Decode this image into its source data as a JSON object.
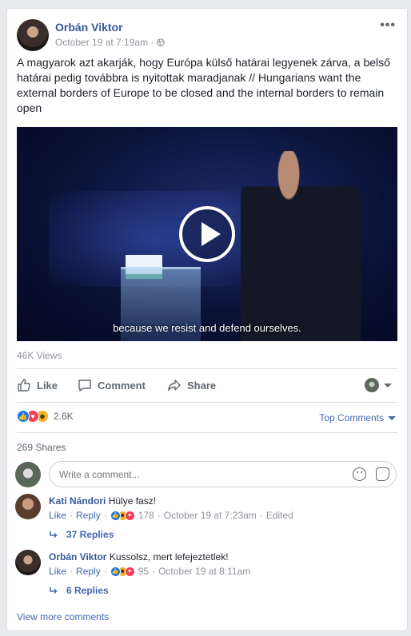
{
  "post": {
    "author": "Orbán Viktor",
    "timestamp": "October 19 at 7:19am",
    "privacy_icon": "globe-icon",
    "more_label": "•••",
    "text": "A magyarok azt akarják, hogy Európa külső határai legyenek zárva, a belső határai pedig továbbra is nyitottak maradjanak // Hungarians want the external borders of Europe to be closed and the internal borders to remain open",
    "video_subtitle": "because we resist and defend ourselves.",
    "views": "46K Views"
  },
  "actions": {
    "like": "Like",
    "comment": "Comment",
    "share": "Share"
  },
  "reactions": {
    "count": "2.6K",
    "types": [
      "like",
      "love",
      "haha"
    ]
  },
  "top_comments": "Top Comments",
  "shares": "269 Shares",
  "comment_input": {
    "placeholder": "Write a comment..."
  },
  "comments": [
    {
      "author": "Kati Nándori",
      "text": "Hülye fasz!",
      "like": "Like",
      "reply": "Reply",
      "reaction_count": "178",
      "timestamp": "October 19 at 7:23am",
      "edited": "Edited",
      "replies": "37 Replies"
    },
    {
      "author": "Orbán Viktor",
      "text": "Kussolsz, mert lefejeztetlek!",
      "like": "Like",
      "reply": "Reply",
      "reaction_count": "95",
      "timestamp": "October 19 at 8:11am",
      "replies": "6 Replies"
    }
  ],
  "view_more": "View more comments",
  "colors": {
    "link": "#365899",
    "accent": "#4267b2",
    "muted": "#90949c",
    "background": "#e9ebee"
  }
}
